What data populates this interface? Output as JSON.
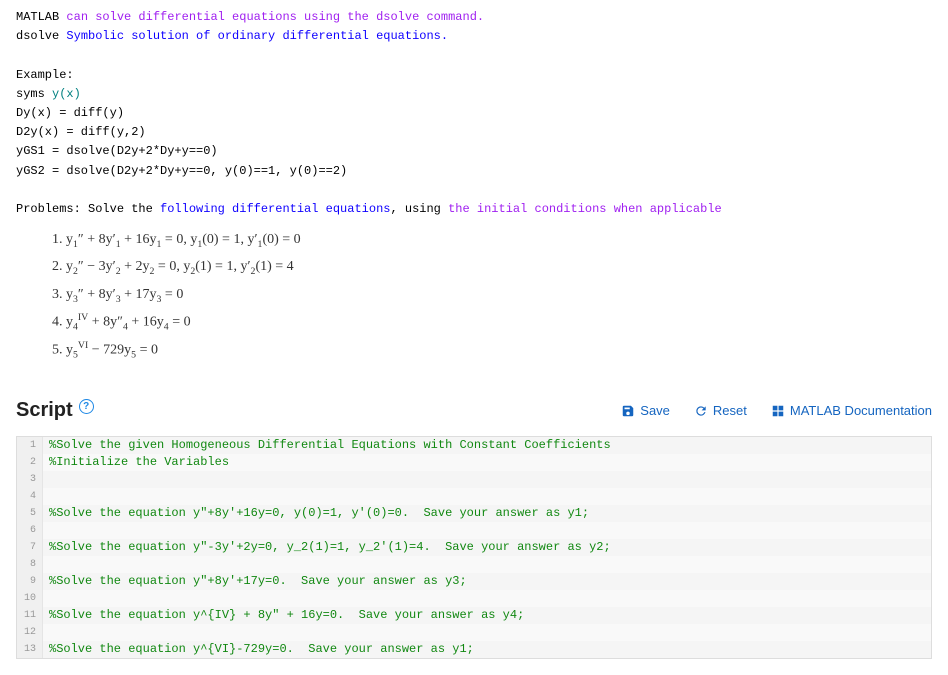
{
  "intro_lines": [
    {
      "segs": [
        {
          "t": "MATLAB ",
          "c": "c-black"
        },
        {
          "t": "can solve differential equations using the dsolve command.",
          "c": "c-purple"
        }
      ]
    },
    {
      "segs": [
        {
          "t": "dsolve ",
          "c": "c-black"
        },
        {
          "t": "Symbolic solution of ordinary differential equations.",
          "c": "c-blue"
        }
      ]
    },
    {
      "segs": [
        {
          "t": " ",
          "c": "c-black"
        }
      ]
    },
    {
      "segs": [
        {
          "t": "Example:",
          "c": "c-black"
        }
      ]
    },
    {
      "segs": [
        {
          "t": "syms ",
          "c": "c-black"
        },
        {
          "t": "y(x)",
          "c": "c-teal"
        }
      ]
    },
    {
      "segs": [
        {
          "t": "Dy(x) = diff(y)",
          "c": "c-black"
        }
      ]
    },
    {
      "segs": [
        {
          "t": "D2y(x) = diff(y,2)",
          "c": "c-black"
        }
      ]
    },
    {
      "segs": [
        {
          "t": "yGS1 = dsolve(D2y+2*Dy+y==0)",
          "c": "c-black"
        }
      ]
    },
    {
      "segs": [
        {
          "t": "yGS2 = dsolve(D2y+2*Dy+y==0, y(0)==1, y(0)==2)",
          "c": "c-black"
        }
      ]
    },
    {
      "segs": [
        {
          "t": " ",
          "c": "c-black"
        }
      ]
    },
    {
      "segs": [
        {
          "t": "Problems: Solve the ",
          "c": "c-black"
        },
        {
          "t": "following differential equations",
          "c": "c-blue"
        },
        {
          "t": ", using ",
          "c": "c-black"
        },
        {
          "t": "the initial conditions when applicable",
          "c": "c-purple"
        }
      ]
    }
  ],
  "problems": [
    "1. y<sub>1</sub>″ + 8y′<sub>1</sub> + 16y<sub>1</sub> = 0, y<sub>1</sub>(0) = 1, y′<sub>1</sub>(0) = 0",
    "2. y<sub>2</sub>″ − 3y′<sub>2</sub> + 2y<sub>2</sub> = 0, y<sub>2</sub>(1) = 1, y′<sub>2</sub>(1) = 4",
    "3. y<sub>3</sub>″ + 8y′<sub>3</sub> + 17y<sub>3</sub> = 0",
    "4. y<sub>4</sub><sup>IV</sup> + 8y″<sub>4</sub> + 16y<sub>4</sub> = 0",
    "5. y<sub>5</sub><sup>VI</sup> − 729y<sub>5</sub> = 0"
  ],
  "script": {
    "title": "Script",
    "help": "?",
    "actions": {
      "save": "Save",
      "reset": "Reset",
      "doc": "MATLAB Documentation"
    }
  },
  "code_lines": [
    {
      "n": "1",
      "t": "%Solve the given Homogeneous Differential Equations with Constant Coefficients",
      "cls": "cmt"
    },
    {
      "n": "2",
      "t": "%Initialize the Variables",
      "cls": "cmt"
    },
    {
      "n": "3",
      "t": "",
      "cls": ""
    },
    {
      "n": "4",
      "t": "",
      "cls": ""
    },
    {
      "n": "5",
      "t": "%Solve the equation y\"+8y'+16y=0, y(0)=1, y'(0)=0.  Save your answer as y1;",
      "cls": "cmt"
    },
    {
      "n": "6",
      "t": "",
      "cls": ""
    },
    {
      "n": "7",
      "t": "%Solve the equation y\"-3y'+2y=0, y_2(1)=1, y_2'(1)=4.  Save your answer as y2;",
      "cls": "cmt"
    },
    {
      "n": "8",
      "t": "",
      "cls": ""
    },
    {
      "n": "9",
      "t": "%Solve the equation y\"+8y'+17y=0.  Save your answer as y3;",
      "cls": "cmt"
    },
    {
      "n": "10",
      "t": "",
      "cls": ""
    },
    {
      "n": "11",
      "t": "%Solve the equation y^{IV} + 8y\" + 16y=0.  Save your answer as y4;",
      "cls": "cmt"
    },
    {
      "n": "12",
      "t": "",
      "cls": ""
    },
    {
      "n": "13",
      "t": "%Solve the equation y^{VI}-729y=0.  Save your answer as y1;",
      "cls": "cmt"
    }
  ]
}
